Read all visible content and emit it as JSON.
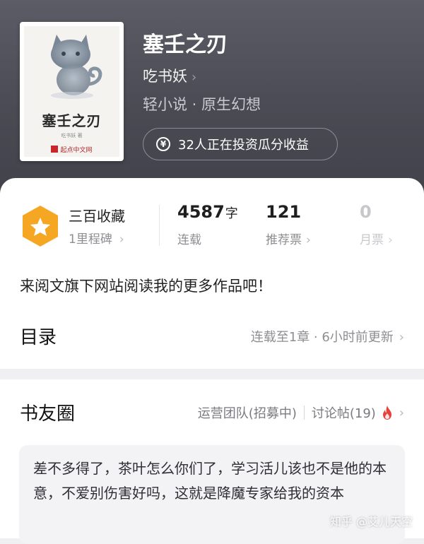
{
  "book": {
    "title": "塞壬之刃",
    "author": "吃书妖",
    "genre": "轻小说 · 原生幻想",
    "invest_text": "32人正在投资瓜分收益",
    "cover": {
      "title": "塞壬之刃",
      "author_line": "吃书妖 著",
      "publisher": "起点中文网"
    }
  },
  "stats": {
    "collect_title": "三百收藏",
    "collect_sub": "1里程碑",
    "words_value": "4587",
    "words_unit": "字",
    "words_label": "连载",
    "rec_value": "121",
    "rec_label": "推荐票",
    "month_value": "0",
    "month_label": "月票"
  },
  "promo_text": "来阅文旗下网站阅读我的更多作品吧！",
  "toc": {
    "title": "目录",
    "status": "连载至1章 · 6小时前更新"
  },
  "circle": {
    "title": "书友圈",
    "ops_link": "运营团队(招募中)",
    "discuss_link": "讨论帖(19)",
    "post_text": "差不多得了，茶叶怎么你们了，学习活儿该也不是他的本意，不爱别伤害好吗，这就是降魔专家给我的资本"
  },
  "icons": {
    "chevron": "›",
    "yen": "¥"
  },
  "colors": {
    "badge_orange": "#f5a623",
    "fire_red": "#e8413c",
    "header_gray": "#4a4a53"
  },
  "watermark": "知乎 @艾儿天空"
}
